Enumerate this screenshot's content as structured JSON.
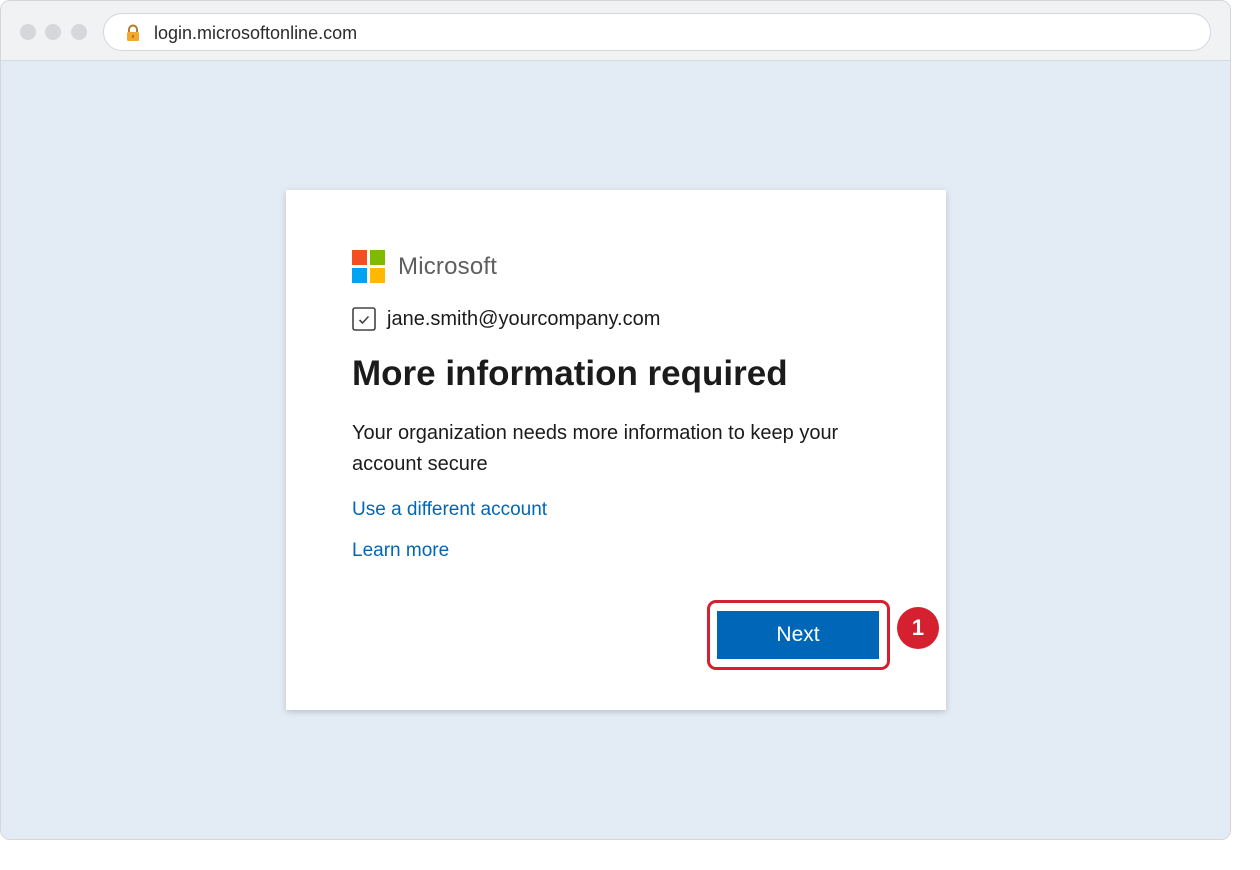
{
  "browser": {
    "url": "login.microsoftonline.com",
    "lock_icon": "lock-icon"
  },
  "card": {
    "brand": "Microsoft",
    "logo_colors": [
      "#f25022",
      "#7fba00",
      "#00a4ef",
      "#ffb900"
    ],
    "account_icon": "account-check-icon",
    "account_email": "jane.smith@yourcompany.com",
    "title": "More information required",
    "description": "Your organization needs more information to keep your account secure",
    "links": [
      {
        "label": "Use a different account"
      },
      {
        "label": "Learn more"
      }
    ],
    "next_button_label": "Next",
    "accent_color": "#0067b8"
  },
  "annotation": {
    "step_number": "1",
    "highlight_color": "#d4202f"
  }
}
